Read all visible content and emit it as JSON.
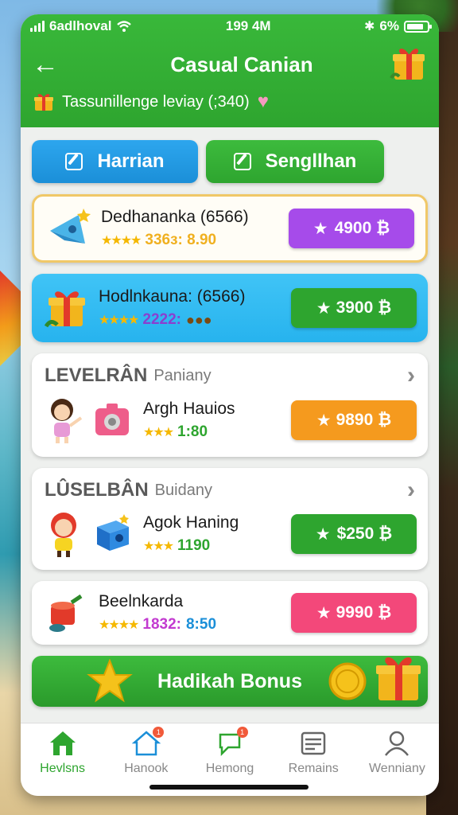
{
  "status": {
    "carrier": "6adlhoval",
    "time": "199 4M",
    "battery": "6%"
  },
  "header": {
    "title": "Casual Canian",
    "subtitle": "Tassunillenge leviay (;340)"
  },
  "tabs": [
    {
      "label": "Harrian"
    },
    {
      "label": "Sengllhan"
    }
  ],
  "items": [
    {
      "name": "Dedhananka (6566)",
      "rating": "336ɜ: 8.90",
      "price": "4900 ₿",
      "price_color": "#a64bea"
    },
    {
      "name": "Hodlnkauna: (6566)",
      "rating": "2222:",
      "price": "3900 ₿",
      "price_color": "#2ea52f"
    }
  ],
  "sections": [
    {
      "title_big": "LEVELRÂN",
      "title_small": "Paniany",
      "item": {
        "name": "Argh Hauios",
        "rating": "1:80",
        "price": "9890 ₿",
        "price_color": "#f59a1e"
      }
    },
    {
      "title_big": "LÛSELBÂN",
      "title_small": "Buidany",
      "item": {
        "name": "Agok Haning",
        "rating": "1190",
        "price": "$250 ₿",
        "price_color": "#2ea52f"
      }
    }
  ],
  "extra_item": {
    "name": "Beelnkarda",
    "rating_a": "1832:",
    "rating_b": "8:50",
    "price": "9990 ₿",
    "price_color": "#f3487a"
  },
  "bonus": {
    "label": "Hadikah Bonus"
  },
  "nav": [
    {
      "label": "Hevlsns",
      "icon": "home-icon"
    },
    {
      "label": "Hanook",
      "icon": "house-outline-icon",
      "badge": "1"
    },
    {
      "label": "Hemong",
      "icon": "chat-icon",
      "badge": "1"
    },
    {
      "label": "Remains",
      "icon": "list-icon"
    },
    {
      "label": "Wenniany",
      "icon": "profile-icon"
    }
  ]
}
